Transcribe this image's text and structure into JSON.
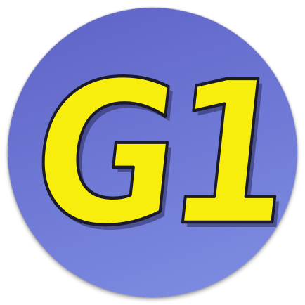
{
  "logo": {
    "text": "G1",
    "colors": {
      "circle_top": "#5e62c6",
      "circle_bottom": "#7f8fe4",
      "glyph_fill": "#f7ee0d",
      "glyph_outline": "#1a1a2a",
      "glyph_shadow": "#2b2c5c"
    }
  }
}
